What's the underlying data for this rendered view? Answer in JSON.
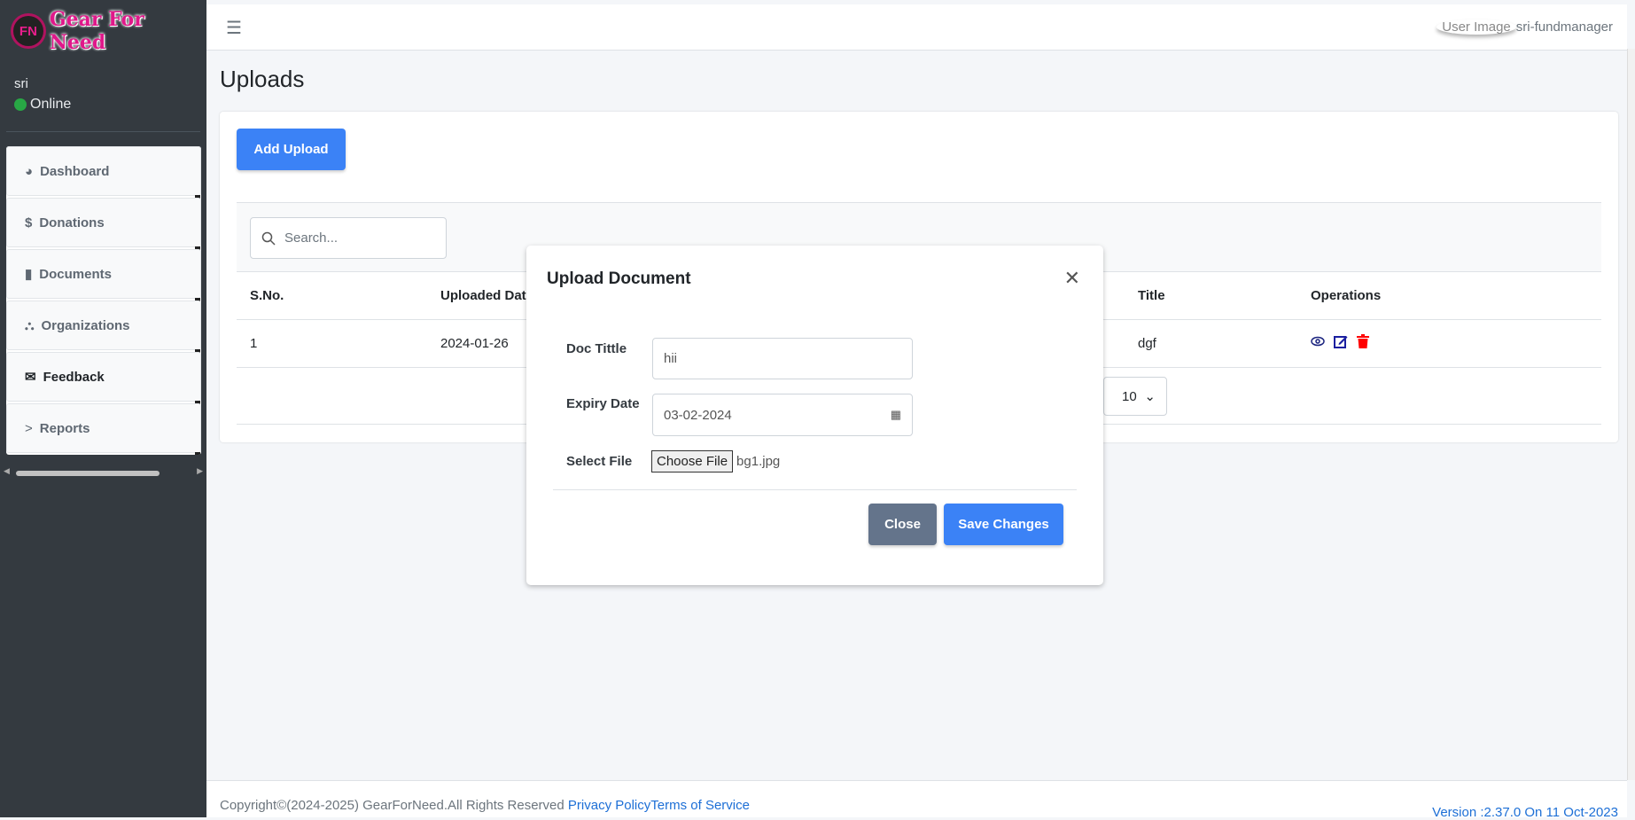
{
  "brand": {
    "logo_text": "Gear For Need",
    "logo_mark": "FN"
  },
  "user": {
    "name": "sri",
    "status": "Online",
    "status_color": "#28a745"
  },
  "sidebar": {
    "items": [
      {
        "label": "Dashboard",
        "icon": "chart-pie-icon"
      },
      {
        "label": "Donations",
        "icon": "donate-icon"
      },
      {
        "label": "Documents",
        "icon": "file-icon"
      },
      {
        "label": "Organizations",
        "icon": "sitemap-icon"
      },
      {
        "label": "Feedback",
        "icon": "envelope-icon"
      },
      {
        "label": "Reports",
        "icon": "chevron-right-icon"
      }
    ]
  },
  "header": {
    "menu_icon": "☰",
    "user_image_alt": "User Image",
    "username": "sri-fundmanager"
  },
  "page": {
    "title": "Uploads",
    "add_button": "Add Upload"
  },
  "table": {
    "search_placeholder": "Search...",
    "columns": [
      "S.No.",
      "Uploaded Date",
      "Title",
      "Operations"
    ],
    "rows": [
      {
        "sno": "1",
        "uploaded": "2024-01-26",
        "title": "dgf"
      }
    ],
    "page_size": "10"
  },
  "modal": {
    "title": "Upload Document",
    "doc_title_label": "Doc Tittle",
    "doc_title_value": "hii",
    "expiry_label": "Expiry Date",
    "expiry_value": "03-02-2024",
    "file_label": "Select File",
    "choose_file": "Choose File",
    "file_name": "bg1.jpg",
    "close_button": "Close",
    "save_button": "Save Changes"
  },
  "footer": {
    "copyright": "Copyright©(2024-2025) GearForNeed.All Rights Reserved ",
    "privacy": "Privacy Policy",
    "terms": "Terms of Service",
    "version": "Version :2.37.0 On 11 Oct-2023"
  },
  "colors": {
    "primary": "#3b82f6",
    "secondary": "#64748b",
    "sidebar": "#343a40",
    "delete": "#ff0000",
    "edit": "#1a237e"
  }
}
